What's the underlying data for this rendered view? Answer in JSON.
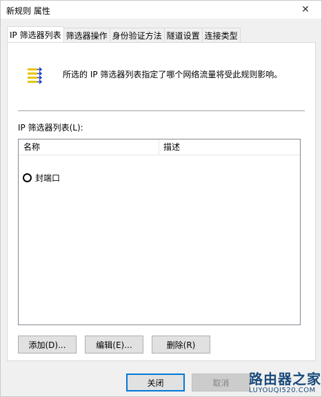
{
  "window": {
    "title": "新规则 属性",
    "close_glyph": "✕"
  },
  "tabs": [
    {
      "label": "IP 筛选器列表"
    },
    {
      "label": "筛选器操作"
    },
    {
      "label": "身份验证方法"
    },
    {
      "label": "隧道设置"
    },
    {
      "label": "连接类型"
    }
  ],
  "panel": {
    "description": "所选的 IP 筛选器列表指定了哪个网络流量将受此规则影响。",
    "list_label": "IP 筛选器列表(L):",
    "columns": {
      "name": "名称",
      "desc": "描述"
    },
    "items": [
      {
        "name": "封端口"
      }
    ]
  },
  "buttons": {
    "add": "添加(D)...",
    "edit": "编辑(E)...",
    "delete": "删除(R)",
    "close": "关闭",
    "cancel": "取消"
  },
  "watermark": {
    "main": "路由器之家",
    "sub": "LUYOUQI520.COM"
  }
}
